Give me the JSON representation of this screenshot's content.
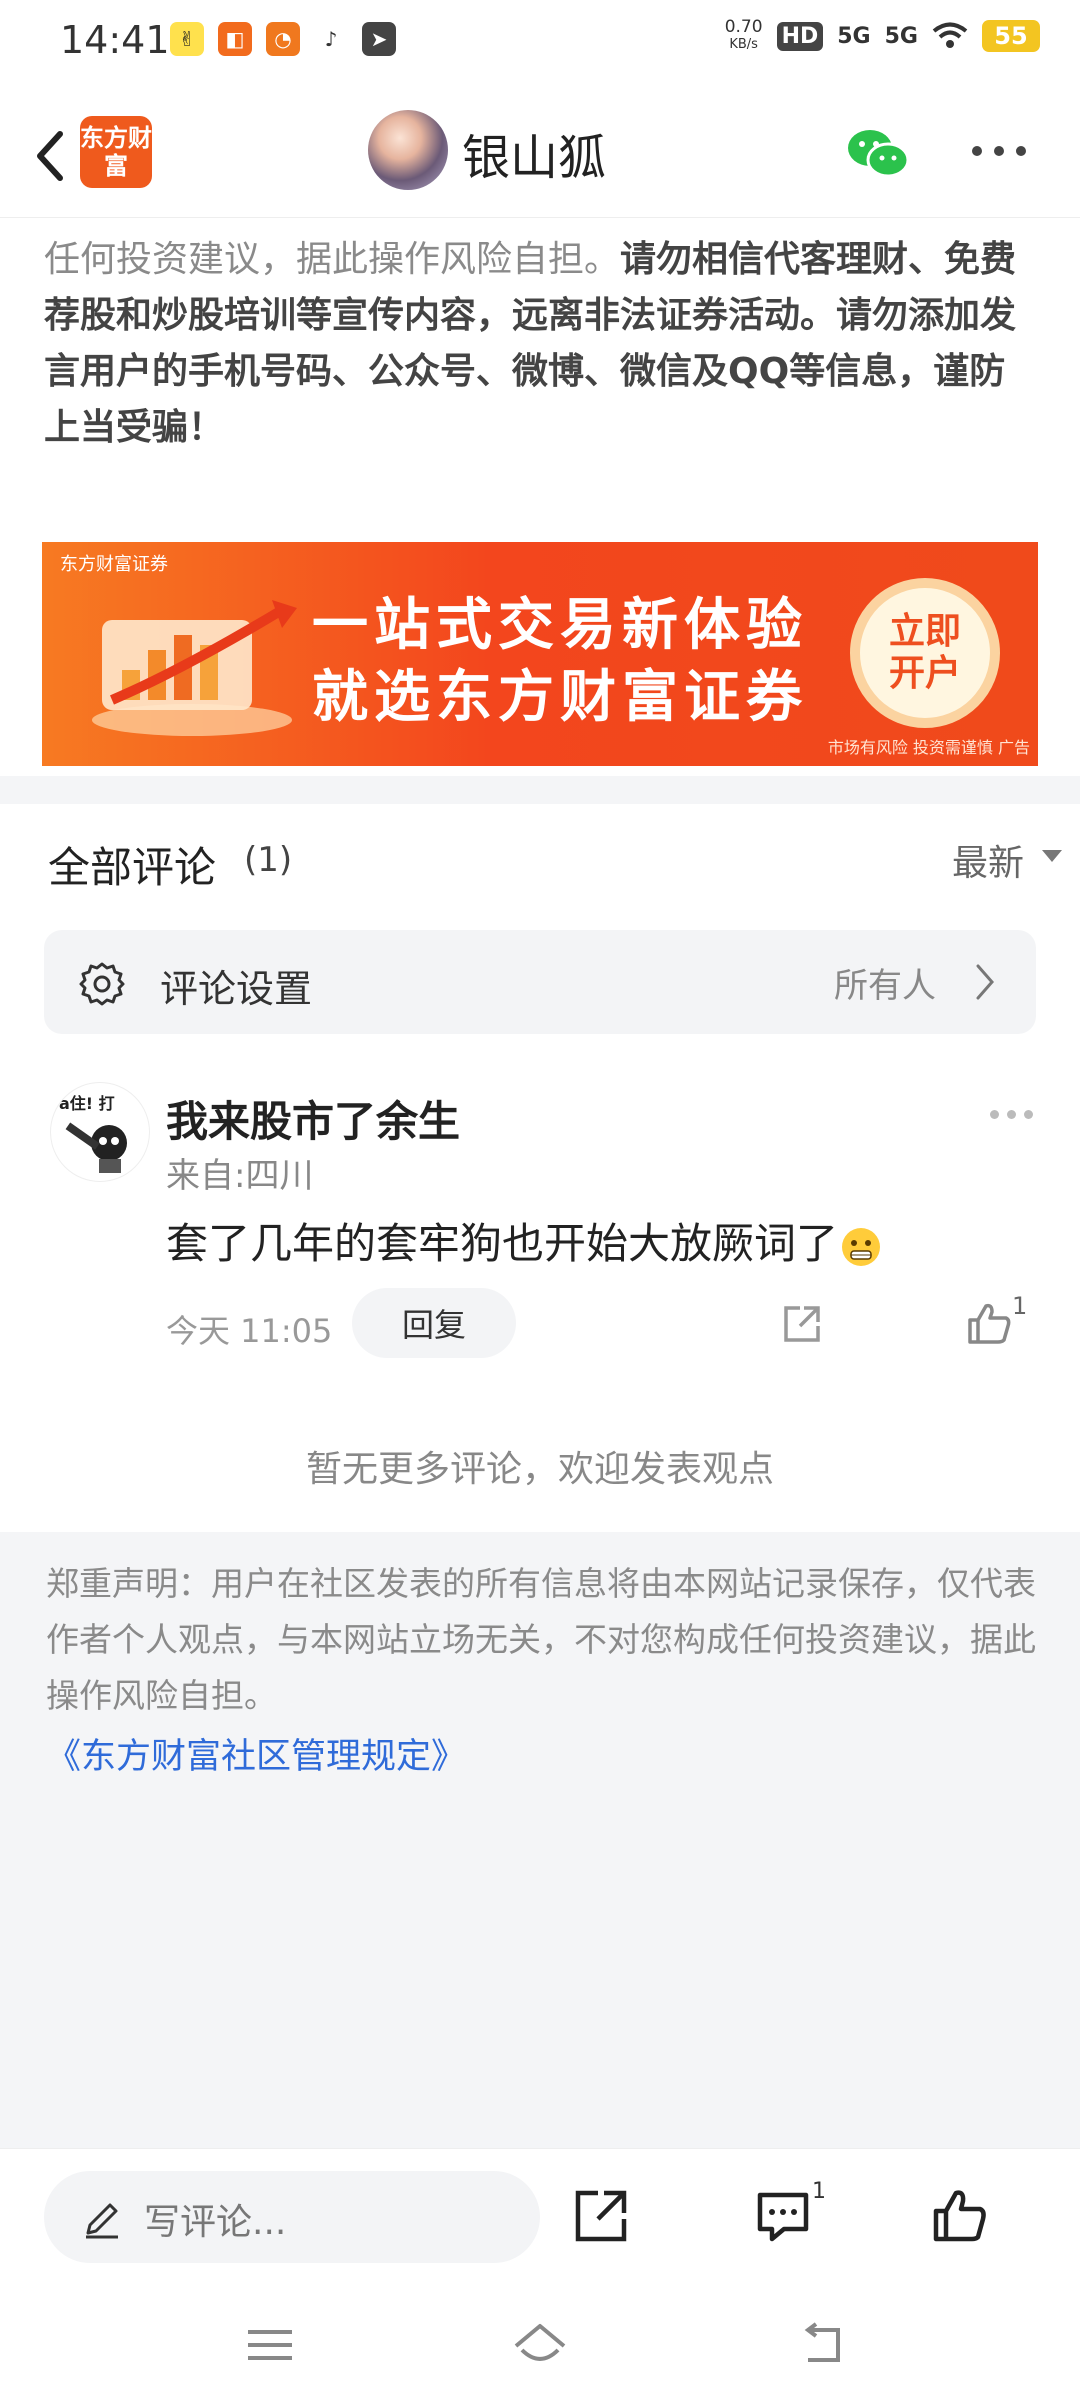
{
  "status_bar": {
    "time": "14:41",
    "network_speed": "0.70",
    "network_speed_unit": "KB/s",
    "hd_label": "HD",
    "signal1": "5G",
    "signal2": "5G",
    "battery": "55"
  },
  "header": {
    "logo_text": "东方财富",
    "title": "银山狐",
    "icons": [
      "back-arrow-icon",
      "wechat-icon",
      "more-icon"
    ]
  },
  "article": {
    "light_text": "任何投资建议，据此操作风险自担。",
    "bold_text": "请勿相信代客理财、免费荐股和炒股培训等宣传内容，远离非法证券活动。请勿添加发言用户的手机号码、公众号、微博、微信及QQ等信息，谨防上当受骗！"
  },
  "banner": {
    "brand": "东方财富证券",
    "line1": "一站式交易新体验",
    "line2": "就选东方财富证券",
    "cta": "立即开户",
    "risk": "市场有风险 投资需谨慎 广告"
  },
  "comments": {
    "heading": "全部评论",
    "count": "(1)",
    "sort": "最新",
    "settings_label": "评论设置",
    "settings_value": "所有人",
    "items": [
      {
        "username": "我来股市了余生",
        "location": "来自:四川",
        "text": "套了几年的套牢狗也开始大放厥词了",
        "emoji": "grimace-emoji",
        "time": "今天 11:05",
        "reply_label": "回复",
        "likes": "1"
      }
    ],
    "no_more": "暂无更多评论，欢迎发表观点"
  },
  "disclaimer": {
    "text": "郑重声明：用户在社区发表的所有信息将由本网站记录保存，仅代表作者个人观点，与本网站立场无关，不对您构成任何投资建议，据此操作风险自担。",
    "link": "《东方财富社区管理规定》"
  },
  "bottom_bar": {
    "placeholder": "写评论...",
    "comment_badge": "1"
  },
  "colors": {
    "brand_orange": "#ef5a1d",
    "link_blue": "#2f6bd9",
    "wechat_green": "#2bc24c"
  }
}
